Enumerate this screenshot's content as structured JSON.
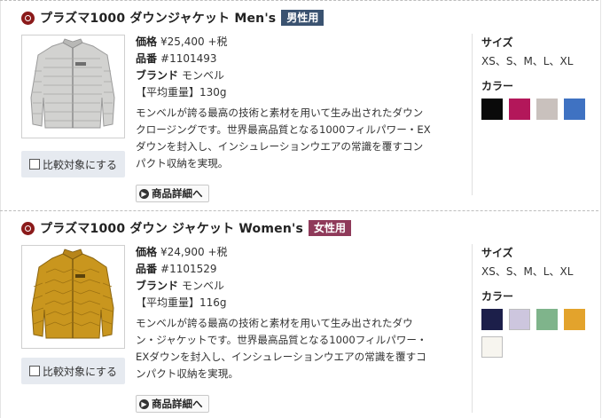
{
  "products": [
    {
      "title": "プラズマ1000 ダウンジャケット Men's",
      "gender_badge": "男性用",
      "badge_color": "#3a5270",
      "jacket_color": "#d2d2d0",
      "price_label": "価格",
      "price": "¥25,400 +税",
      "code_label": "品番",
      "code": "#1101493",
      "brand_label": "ブランド",
      "brand": "モンベル",
      "weight_label": "【平均重量】",
      "weight": "130g",
      "desc_lines": [
        "モンベルが誇る最高の技術と素材を用いて生み出されたダウン",
        "クロージングです。世界最高品質となる1000フィルパワー・EX",
        "ダウンを封入し、インシュレーションウエアの常識を覆すコン",
        "パクト収納を実現。"
      ],
      "compare_label": "比較対象にする",
      "detail_label": "商品詳細へ",
      "size_heading": "サイズ",
      "sizes": "XS、S、M、L、XL",
      "color_heading": "カラー",
      "colors": [
        {
          "name": "black",
          "hex": "#0a0a0a"
        },
        {
          "name": "magenta",
          "hex": "#b3175a"
        },
        {
          "name": "light-gray",
          "hex": "#c9c1bd"
        },
        {
          "name": "blue",
          "hex": "#3f72c2"
        }
      ]
    },
    {
      "title": "プラズマ1000 ダウン ジャケット Women's",
      "gender_badge": "女性用",
      "badge_color": "#8f3a5a",
      "jacket_color": "#c9961e",
      "price_label": "価格",
      "price": "¥24,900 +税",
      "code_label": "品番",
      "code": "#1101529",
      "brand_label": "ブランド",
      "brand": "モンベル",
      "weight_label": "【平均重量】",
      "weight": "116g",
      "desc_lines": [
        "モンベルが誇る最高の技術と素材を用いて生み出されたダウ",
        "ン・ジャケットです。世界最高品質となる1000フィルパワー・",
        "EXダウンを封入し、インシュレーションウエアの常識を覆すコ",
        "ンパクト収納を実現。"
      ],
      "compare_label": "比較対象にする",
      "detail_label": "商品詳細へ",
      "size_heading": "サイズ",
      "sizes": "XS、S、M、L、XL",
      "color_heading": "カラー",
      "colors": [
        {
          "name": "navy",
          "hex": "#1c1f4a"
        },
        {
          "name": "lavender",
          "hex": "#cdc6de"
        },
        {
          "name": "sage-green",
          "hex": "#7fb48b"
        },
        {
          "name": "mustard",
          "hex": "#e3a32c"
        },
        {
          "name": "off-white",
          "hex": "#f7f5ef"
        }
      ]
    }
  ]
}
